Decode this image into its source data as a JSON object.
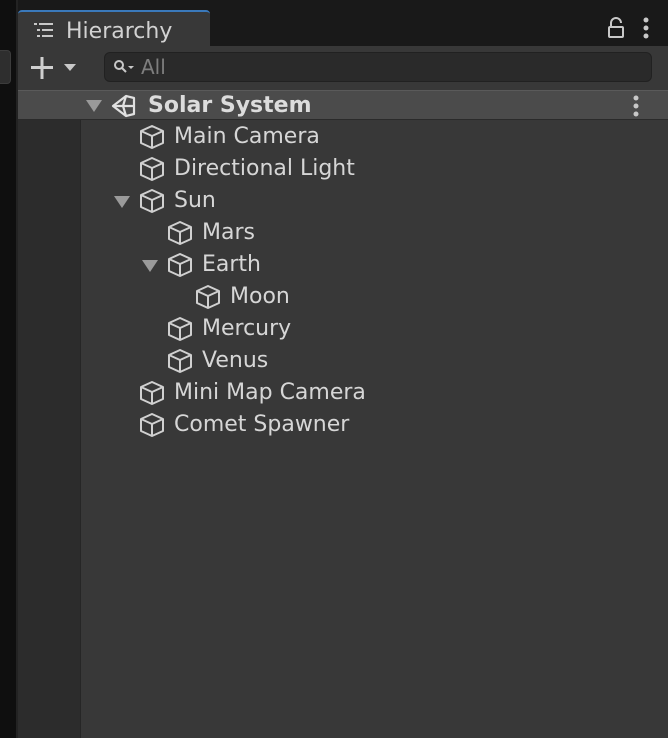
{
  "window": {
    "tab_label": "Hierarchy",
    "tab_icon": "list-icon",
    "lock_icon": "lock-icon",
    "menu_icon": "kebab-menu-icon"
  },
  "toolbar": {
    "add_icon": "plus-dropdown-icon",
    "search_icon": "search-icon",
    "search_placeholder": "All",
    "search_value": ""
  },
  "scene": {
    "label": "Solar System",
    "icon": "unity-scene-icon",
    "expanded": true,
    "menu_icon": "kebab-menu-icon"
  },
  "items": [
    {
      "label": "Main Camera",
      "depth": 1,
      "expanded": null
    },
    {
      "label": "Directional Light",
      "depth": 1,
      "expanded": null
    },
    {
      "label": "Sun",
      "depth": 1,
      "expanded": true
    },
    {
      "label": "Mars",
      "depth": 2,
      "expanded": null
    },
    {
      "label": "Earth",
      "depth": 2,
      "expanded": true
    },
    {
      "label": "Moon",
      "depth": 3,
      "expanded": null
    },
    {
      "label": "Mercury",
      "depth": 2,
      "expanded": null
    },
    {
      "label": "Venus",
      "depth": 2,
      "expanded": null
    },
    {
      "label": "Mini Map Camera",
      "depth": 1,
      "expanded": null
    },
    {
      "label": "Comet Spawner",
      "depth": 1,
      "expanded": null
    }
  ],
  "colors": {
    "panel_bg": "#383838",
    "tab_accent": "#3a79bb",
    "selected_row": "#4b4b4b",
    "text": "#d6d6d6"
  }
}
